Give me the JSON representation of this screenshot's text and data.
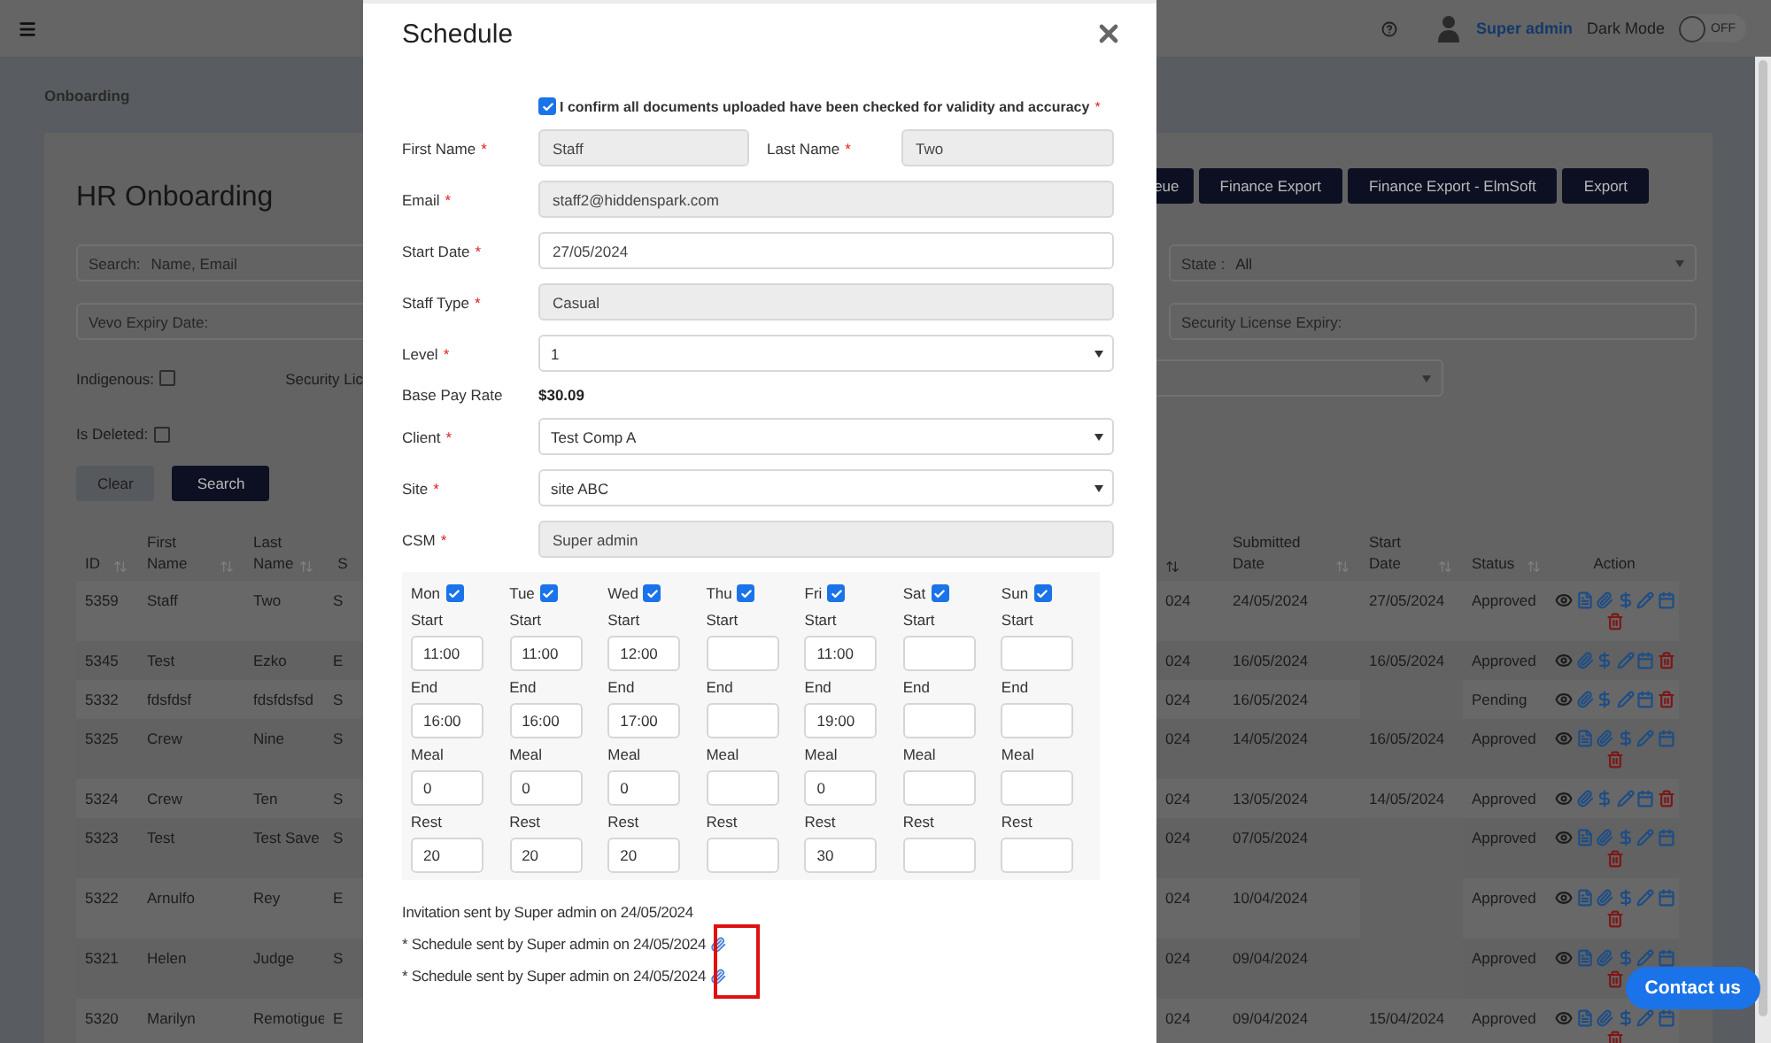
{
  "header": {
    "user": "Super admin",
    "dark_mode": {
      "label": "Dark Mode",
      "on": false,
      "state_text": "OFF"
    }
  },
  "breadcrumb": "Onboarding",
  "page": {
    "title": "HR Onboarding",
    "buttons": [
      "eue",
      "Finance Export",
      "Finance Export - ElmSoft",
      "Export"
    ]
  },
  "filters": {
    "search": {
      "label": "Search:",
      "placeholder": "Name, Email"
    },
    "state": {
      "label": "State :",
      "value": "All"
    },
    "vevo_expiry": {
      "placeholder": "Vevo Expiry Date:"
    },
    "security_expiry": {
      "placeholder": "Security License Expiry:"
    },
    "indigenous": {
      "label": "Indigenous:",
      "checked": false
    },
    "security_licence_label": "Security Lic",
    "is_deleted": {
      "label": "Is Deleted:",
      "checked": false
    },
    "buttons": [
      {
        "label": "Clear",
        "kind": "secondary"
      },
      {
        "label": "Search",
        "kind": "primary"
      }
    ]
  },
  "table": {
    "columns": [
      {
        "label": "ID",
        "sortable": true
      },
      {
        "label": "First Name",
        "sortable": true
      },
      {
        "label": "Last Name",
        "sortable": true
      },
      {
        "label": "S",
        "sortable": false
      },
      {
        "sortable": true
      },
      {
        "label": "Submitted Date",
        "sortable": true
      },
      {
        "label": "Start Date",
        "sortable": true
      },
      {
        "label": "Status",
        "sortable": true
      },
      {
        "label": "Action",
        "sortable": false
      }
    ],
    "rows": [
      {
        "id": "5359",
        "first_name": "Staff",
        "last_name": "Two",
        "column_4": "S",
        "column_5": "024",
        "submitted_date": "24/05/2024",
        "start_date": "27/05/2024",
        "status": "Approved",
        "actions": [
          {
            "kind": "view"
          },
          {
            "kind": "document"
          },
          {
            "kind": "attach"
          },
          {
            "kind": "pay"
          },
          {
            "kind": "edit"
          },
          {
            "kind": "schedule"
          },
          {
            "kind": "delete"
          }
        ]
      },
      {
        "id": "5345",
        "first_name": "Test",
        "last_name": "Ezko",
        "column_4": "E",
        "column_5": "024",
        "submitted_date": "16/05/2024",
        "start_date": "16/05/2024",
        "status": "Approved",
        "actions": [
          {
            "kind": "view"
          },
          {
            "kind": "attach"
          },
          {
            "kind": "pay"
          },
          {
            "kind": "edit"
          },
          {
            "kind": "schedule"
          },
          {
            "kind": "delete"
          }
        ]
      },
      {
        "id": "5332",
        "first_name": "fdsfdsf",
        "last_name": "fdsfdsfsd",
        "column_4": "S",
        "column_5": "024",
        "submitted_date": "16/05/2024",
        "status": "Pending",
        "actions": [
          {
            "kind": "view"
          },
          {
            "kind": "attach"
          },
          {
            "kind": "pay"
          },
          {
            "kind": "edit"
          },
          {
            "kind": "schedule"
          },
          {
            "kind": "delete"
          }
        ]
      },
      {
        "id": "5325",
        "first_name": "Crew",
        "last_name": "Nine",
        "column_4": "S",
        "column_5": "024",
        "submitted_date": "14/05/2024",
        "start_date": "16/05/2024",
        "status": "Approved",
        "actions": [
          {
            "kind": "view"
          },
          {
            "kind": "document"
          },
          {
            "kind": "attach"
          },
          {
            "kind": "pay"
          },
          {
            "kind": "edit"
          },
          {
            "kind": "schedule"
          },
          {
            "kind": "delete"
          }
        ]
      },
      {
        "id": "5324",
        "first_name": "Crew",
        "last_name": "Ten",
        "column_4": "S",
        "column_5": "024",
        "submitted_date": "13/05/2024",
        "start_date": "14/05/2024",
        "status": "Approved",
        "actions": [
          {
            "kind": "view"
          },
          {
            "kind": "attach"
          },
          {
            "kind": "pay"
          },
          {
            "kind": "edit"
          },
          {
            "kind": "schedule"
          },
          {
            "kind": "delete"
          }
        ]
      },
      {
        "id": "5323",
        "first_name": "Test",
        "last_name": "Test Save",
        "column_4": "S",
        "column_5": "024",
        "submitted_date": "07/05/2024",
        "status": "Approved",
        "actions": [
          {
            "kind": "view"
          },
          {
            "kind": "document"
          },
          {
            "kind": "attach"
          },
          {
            "kind": "pay"
          },
          {
            "kind": "edit"
          },
          {
            "kind": "schedule"
          },
          {
            "kind": "delete"
          }
        ]
      },
      {
        "id": "5322",
        "first_name": "Arnulfo",
        "last_name": "Rey",
        "column_4": "E",
        "column_5": "024",
        "submitted_date": "10/04/2024",
        "status": "Approved",
        "actions": [
          {
            "kind": "view"
          },
          {
            "kind": "document"
          },
          {
            "kind": "attach"
          },
          {
            "kind": "pay"
          },
          {
            "kind": "edit"
          },
          {
            "kind": "schedule"
          },
          {
            "kind": "delete"
          }
        ]
      },
      {
        "id": "5321",
        "first_name": "Helen",
        "last_name": "Judge",
        "column_4": "S",
        "column_5": "024",
        "submitted_date": "09/04/2024",
        "status": "Approved",
        "actions": [
          {
            "kind": "view"
          },
          {
            "kind": "document"
          },
          {
            "kind": "attach"
          },
          {
            "kind": "pay"
          },
          {
            "kind": "edit"
          },
          {
            "kind": "schedule"
          },
          {
            "kind": "delete"
          }
        ]
      },
      {
        "id": "5320",
        "first_name": "Marilyn",
        "last_name": "Remotigue",
        "column_4": "E",
        "column_5": "024",
        "submitted_date": "09/04/2024",
        "start_date": "15/04/2024",
        "status": "Approved",
        "actions": [
          {
            "kind": "view"
          },
          {
            "kind": "document"
          },
          {
            "kind": "attach"
          },
          {
            "kind": "pay"
          },
          {
            "kind": "edit"
          },
          {
            "kind": "schedule"
          },
          {
            "kind": "delete"
          }
        ]
      }
    ]
  },
  "modal": {
    "title": "Schedule",
    "confirmation": {
      "checked": true,
      "text": "I confirm all documents uploaded have been checked for validity and accuracy",
      "required_mark": "*"
    },
    "form_rows": [
      {
        "fields": [
          {
            "label": "First Name",
            "required_mark": "*",
            "kind": "readonly",
            "value": "Staff"
          },
          {
            "label": "Last Name",
            "required_mark": "*",
            "kind": "readonly",
            "value": "Two"
          }
        ]
      },
      {
        "fields": [
          {
            "label": "Email",
            "required_mark": "*",
            "kind": "readonly",
            "value": "staff2@hiddenspark.com"
          }
        ]
      },
      {
        "fields": [
          {
            "label": "Start Date",
            "required_mark": "*",
            "kind": "input",
            "value": "27/05/2024"
          }
        ]
      },
      {
        "fields": [
          {
            "label": "Staff Type",
            "required_mark": "*",
            "kind": "readonly",
            "value": "Casual"
          }
        ]
      },
      {
        "fields": [
          {
            "label": "Level",
            "required_mark": "*",
            "kind": "select",
            "value": "1"
          }
        ]
      },
      {
        "fields": [
          {
            "label": "Base Pay Rate",
            "kind": "text",
            "value": "$30.09"
          }
        ]
      },
      {
        "fields": [
          {
            "label": "Client",
            "required_mark": "*",
            "kind": "select",
            "value": "Test Comp A"
          }
        ]
      },
      {
        "fields": [
          {
            "label": "Site",
            "required_mark": "*",
            "kind": "select",
            "value": "site ABC"
          }
        ]
      },
      {
        "fields": [
          {
            "label": "CSM",
            "required_mark": "*",
            "kind": "readonly",
            "value": "Super admin"
          }
        ]
      }
    ],
    "days": [
      {
        "label": "Mon",
        "checked": true,
        "fields": [
          {
            "label": "Start",
            "value": "11:00"
          },
          {
            "label": "End",
            "value": "16:00"
          },
          {
            "label": "Meal",
            "value": "0"
          },
          {
            "label": "Rest",
            "value": "20"
          }
        ]
      },
      {
        "label": "Tue",
        "checked": true,
        "fields": [
          {
            "label": "Start",
            "value": "11:00"
          },
          {
            "label": "End",
            "value": "16:00"
          },
          {
            "label": "Meal",
            "value": "0"
          },
          {
            "label": "Rest",
            "value": "20"
          }
        ]
      },
      {
        "label": "Wed",
        "checked": true,
        "fields": [
          {
            "label": "Start",
            "value": "12:00"
          },
          {
            "label": "End",
            "value": "17:00"
          },
          {
            "label": "Meal",
            "value": "0"
          },
          {
            "label": "Rest",
            "value": "20"
          }
        ]
      },
      {
        "label": "Thu",
        "checked": true,
        "fields": [
          {
            "label": "Start"
          },
          {
            "label": "End"
          },
          {
            "label": "Meal"
          },
          {
            "label": "Rest"
          }
        ]
      },
      {
        "label": "Fri",
        "checked": true,
        "fields": [
          {
            "label": "Start",
            "value": "11:00"
          },
          {
            "label": "End",
            "value": "19:00"
          },
          {
            "label": "Meal",
            "value": "0"
          },
          {
            "label": "Rest",
            "value": "30"
          }
        ]
      },
      {
        "label": "Sat",
        "checked": true,
        "fields": [
          {
            "label": "Start"
          },
          {
            "label": "End"
          },
          {
            "label": "Meal"
          },
          {
            "label": "Rest"
          }
        ]
      },
      {
        "label": "Sun",
        "checked": true,
        "fields": [
          {
            "label": "Start"
          },
          {
            "label": "End"
          },
          {
            "label": "Meal"
          },
          {
            "label": "Rest"
          }
        ]
      }
    ],
    "notes": [
      {
        "text": "Invitation sent by Super admin on 24/05/2024",
        "attachment": false
      },
      {
        "text": "* Schedule sent by Super admin on 24/05/2024",
        "attachment": true
      },
      {
        "text": "* Schedule sent by Super admin on 24/05/2024",
        "attachment": true
      }
    ]
  },
  "contact_button": "Contact us"
}
